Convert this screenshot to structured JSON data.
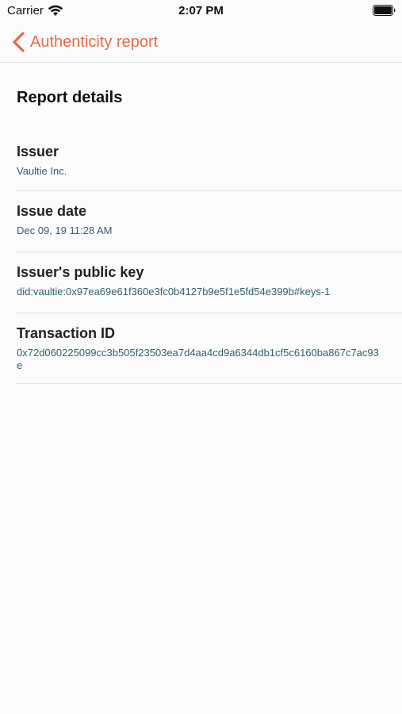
{
  "status_bar": {
    "carrier": "Carrier",
    "time": "2:07 PM"
  },
  "nav": {
    "back_label": "Authenticity report",
    "accent_color": "#e36a4b"
  },
  "report": {
    "section_title": "Report details",
    "fields": [
      {
        "label": "Issuer",
        "value": "Vaultie Inc."
      },
      {
        "label": "Issue date",
        "value": "Dec 09, 19 11:28 AM"
      },
      {
        "label": "Issuer's public key",
        "value": "did:vaultie:0x97ea69e61f360e3fc0b4127b9e5f1e5fd54e399b#keys-1"
      },
      {
        "label": "Transaction ID",
        "value": "0x72d060225099cc3b505f23503ea7d4aa4cd9a6344db1cf5c6160ba867c7ac93e"
      }
    ]
  },
  "icons": {
    "wifi": "wifi-icon",
    "battery": "battery-icon",
    "back": "chevron-left-icon"
  },
  "colors": {
    "value_text": "#2f6070",
    "background": "#fbfbfb"
  }
}
